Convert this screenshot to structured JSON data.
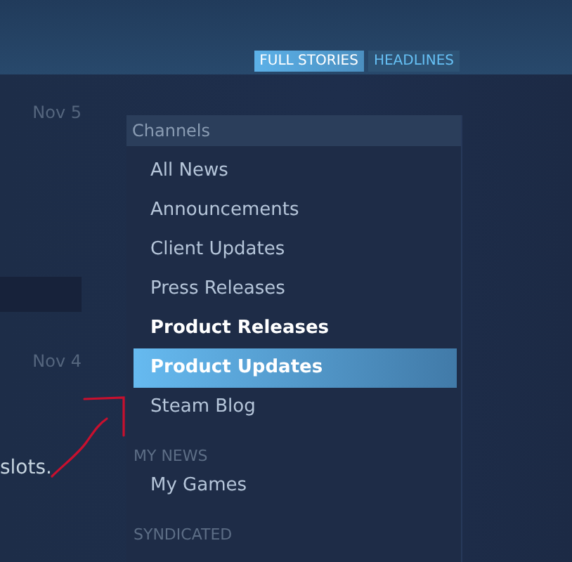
{
  "view_toggle": [
    {
      "label": "FULL STORIES",
      "selected": true
    },
    {
      "label": "HEADLINES",
      "selected": false
    }
  ],
  "feed": {
    "dates": [
      "Nov 5",
      "Nov 4"
    ],
    "text_fragment": "slots."
  },
  "channels": {
    "title": "Channels",
    "sections": [
      {
        "items": [
          {
            "label": "All News",
            "selected": false,
            "hovered": false
          },
          {
            "label": "Announcements",
            "selected": false,
            "hovered": false
          },
          {
            "label": "Client Updates",
            "selected": false,
            "hovered": false
          },
          {
            "label": "Press Releases",
            "selected": false,
            "hovered": false
          },
          {
            "label": "Product Releases",
            "selected": false,
            "hovered": true
          },
          {
            "label": "Product Updates",
            "selected": true,
            "hovered": false
          },
          {
            "label": "Steam Blog",
            "selected": false,
            "hovered": false
          }
        ]
      },
      {
        "heading": "MY NEWS",
        "items": [
          {
            "label": "My Games",
            "selected": false,
            "hovered": false
          }
        ]
      },
      {
        "heading": "SYNDICATED"
      }
    ]
  }
}
